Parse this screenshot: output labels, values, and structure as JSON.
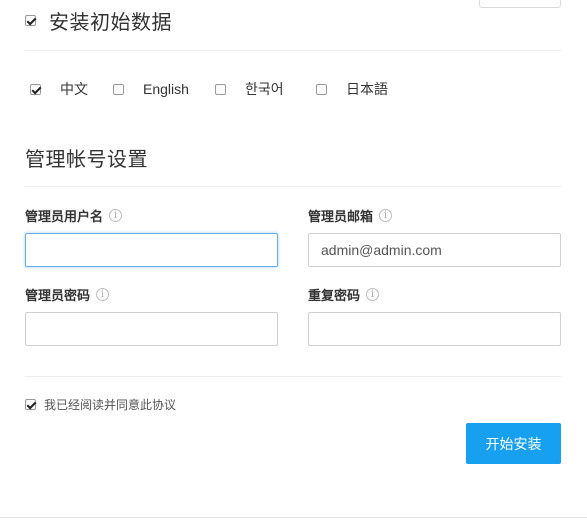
{
  "install_init": {
    "label": "安装初始数据",
    "checked": true
  },
  "languages": [
    {
      "label": "中文",
      "checked": true
    },
    {
      "label": "English",
      "checked": false
    },
    {
      "label": "한국어",
      "checked": false
    },
    {
      "label": "日本語",
      "checked": false
    }
  ],
  "admin_section": {
    "title": "管理帐号设置",
    "username": {
      "label": "管理员用户名",
      "value": "",
      "placeholder": ""
    },
    "email": {
      "label": "管理员邮箱",
      "value": "admin@admin.com",
      "placeholder": ""
    },
    "password": {
      "label": "管理员密码",
      "value": "",
      "placeholder": ""
    },
    "confirm_password": {
      "label": "重复密码",
      "value": "",
      "placeholder": ""
    },
    "info_glyph": "i"
  },
  "agreement": {
    "label": "我已经阅读并同意此协议",
    "checked": true
  },
  "start_button": {
    "label": "开始安装"
  },
  "colors": {
    "accent": "#18a0f0",
    "focus_border": "#66afe9"
  }
}
